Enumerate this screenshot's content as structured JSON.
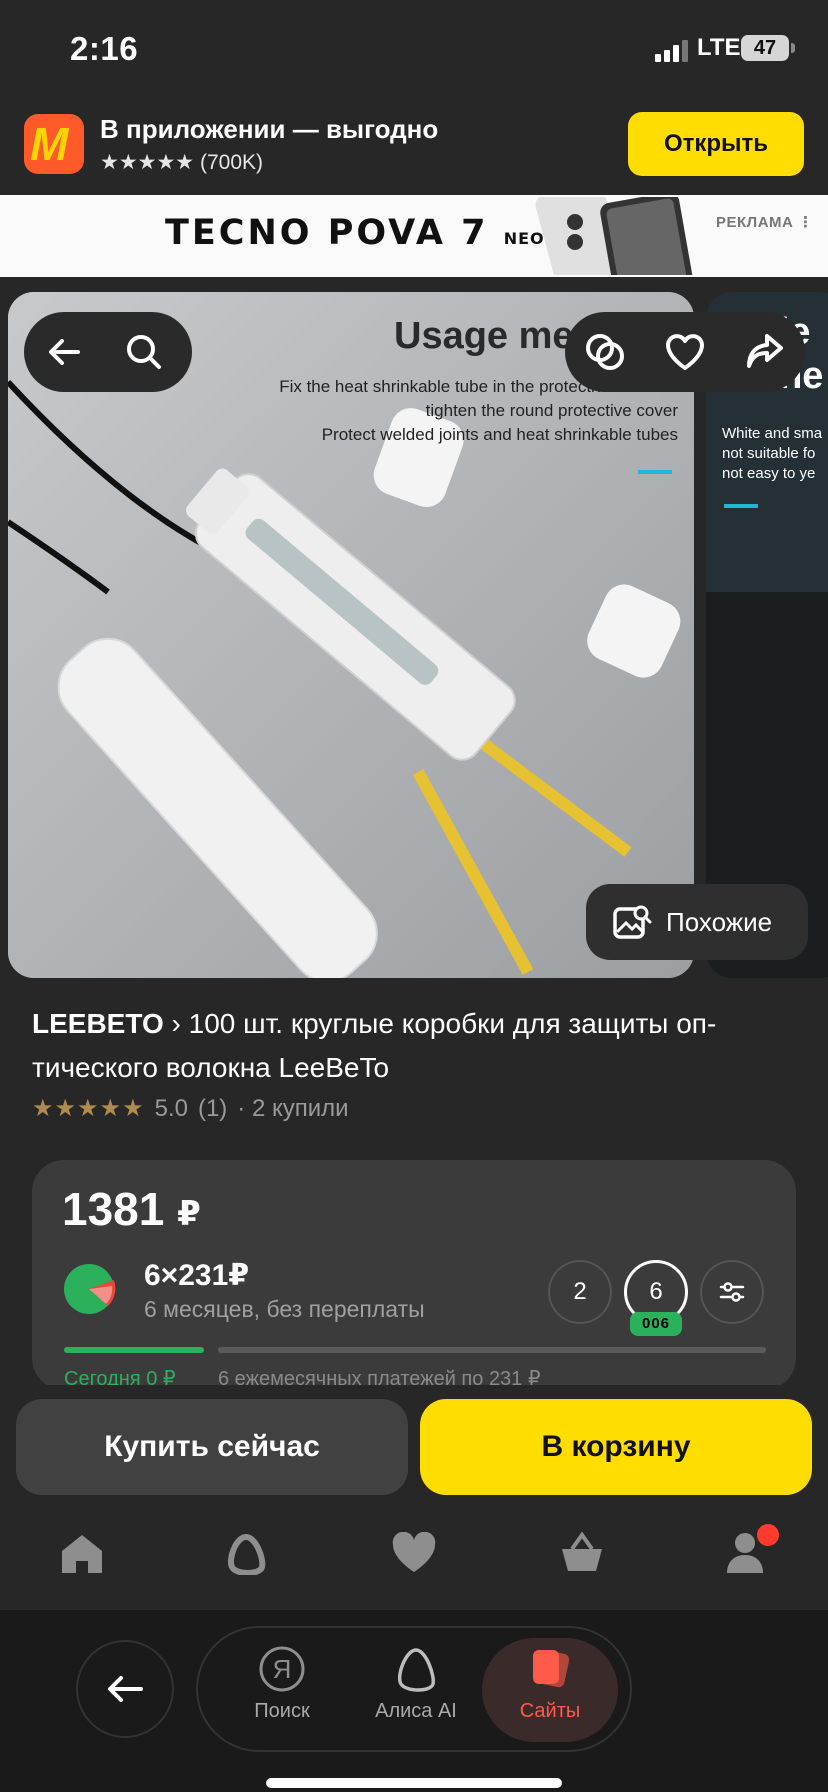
{
  "status": {
    "time": "2:16",
    "network": "LTE",
    "battery": "47"
  },
  "app_banner": {
    "title": "В приложении — выгодно",
    "stars": "★★★★★",
    "rating": "(700K)",
    "open_button": "Открыть"
  },
  "ad": {
    "brand": "TECNO POVA 7",
    "brand_suffix": "NEO",
    "label": "РЕКЛАМА"
  },
  "gallery": {
    "image_title": "Usage method",
    "image_lines": [
      "Fix the heat shrinkable tube in the protective box and",
      "tighten the round protective cover",
      "Protect welded joints and heat shrinkable tubes"
    ],
    "next_title": "Wide",
    "next_title2": "to the",
    "next_lines": [
      "White and sma",
      "not suitable fo",
      "not easy to ye"
    ],
    "similar_label": "Похожие"
  },
  "product": {
    "brand": "LEEBETO",
    "title": "100 шт. круглые коробки для защиты оп-тического волокна LeeBeTo",
    "title_line1": "100 шт. круглые коробки для защиты оп-",
    "title_line2": "тического волокна LeeBeTo",
    "stars": "★★★★★",
    "rating": "5.0",
    "reviews": "(1)",
    "bought": "· 2 купили"
  },
  "price": {
    "value": "1381",
    "currency": "₽",
    "split_amount": "6×231₽",
    "split_note": "6 месяцев, без переплаты",
    "option_2": "2",
    "option_6": "6",
    "option_6_badge": "006",
    "today": "Сегодня 0 ₽",
    "monthly": "6 ежемесячных платежей по 231 ₽"
  },
  "actions": {
    "buy_now": "Купить сейчас",
    "add_to_cart": "В корзину"
  },
  "browser_nav": {
    "search": "Поиск",
    "alice": "Алиса AI",
    "sites": "Сайты"
  },
  "colors": {
    "accent": "#ffdd00",
    "green": "#2bb05b",
    "notification": "#ff3b30"
  }
}
